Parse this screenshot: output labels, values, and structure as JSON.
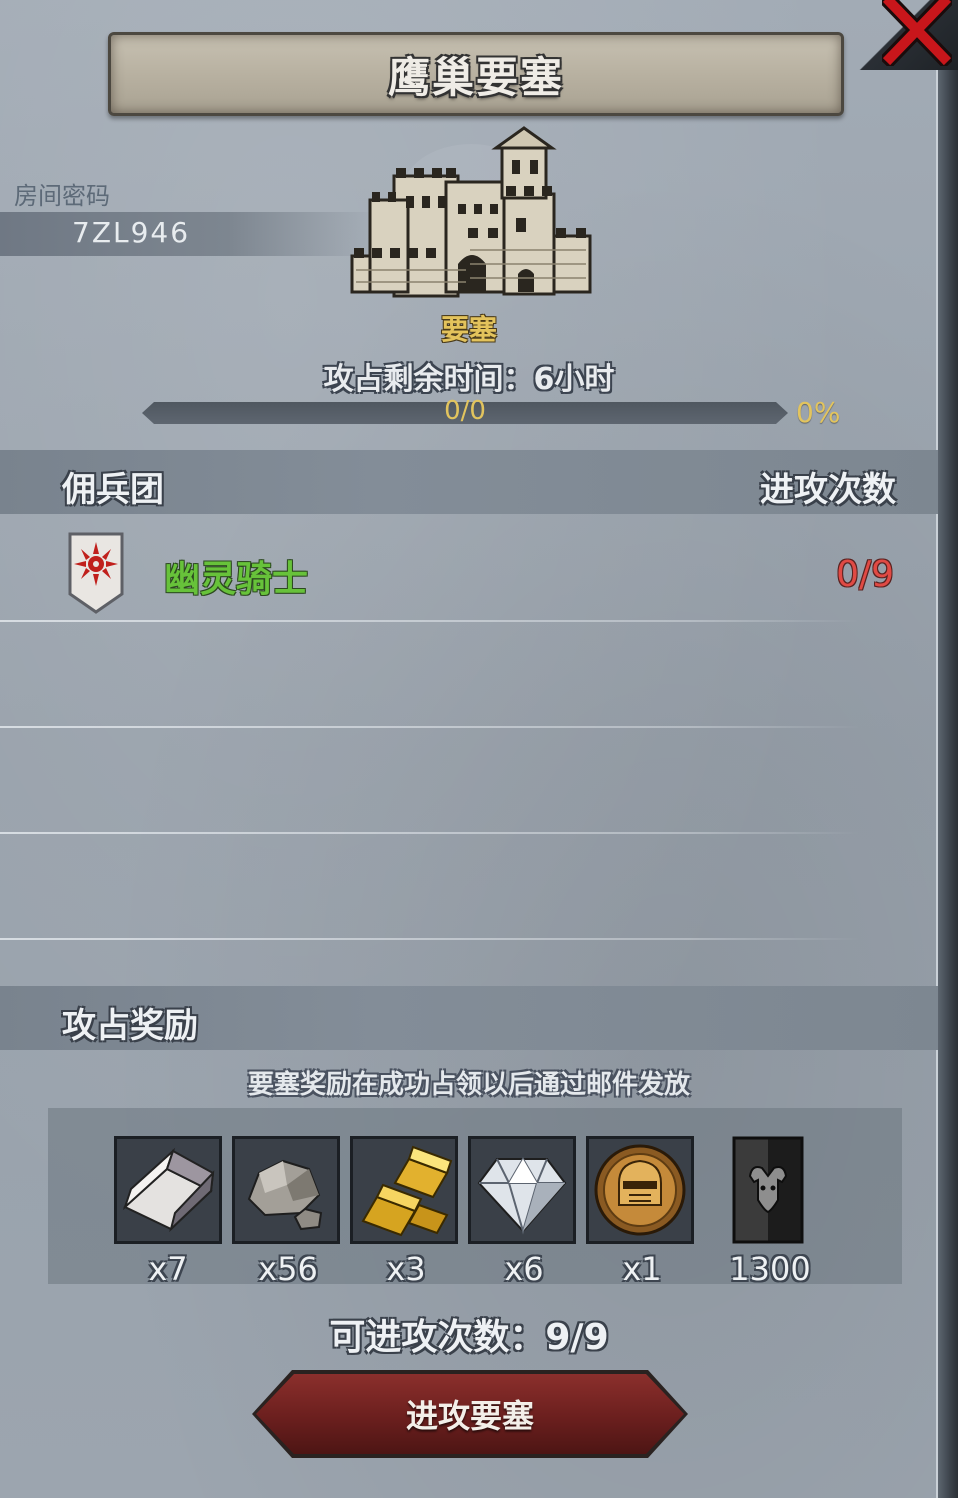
{
  "title": "鹰巢要塞",
  "room": {
    "label": "房间密码",
    "code": "7ZL946"
  },
  "fortress": {
    "type_label": "要塞",
    "time_label": "攻占剩余时间：6小时",
    "progress_text": "0/0",
    "progress_percent": "0%",
    "progress_fraction": 0
  },
  "mercenaries": {
    "header_left": "佣兵团",
    "header_right": "进攻次数",
    "items": [
      {
        "name": "幽灵骑士",
        "attacks": "0/9",
        "emblem_icon": "red-sun-shield-icon"
      }
    ]
  },
  "rewards": {
    "header": "攻占奖励",
    "note": "要塞奖励在成功占领以后通过邮件发放",
    "items": [
      {
        "icon": "silver-ingot-icon",
        "qty": "x7"
      },
      {
        "icon": "stone-ore-icon",
        "qty": "x56"
      },
      {
        "icon": "gold-bars-icon",
        "qty": "x3"
      },
      {
        "icon": "diamond-icon",
        "qty": "x6"
      },
      {
        "icon": "knight-helmet-medal-icon",
        "qty": "x1"
      },
      {
        "icon": "bull-banner-icon",
        "qty": "1300"
      }
    ]
  },
  "attacks_available": "可进攻次数：9/9",
  "attack_button_label": "进攻要塞",
  "colors": {
    "merc_name": "#67c23a",
    "merc_count": "#e04a44",
    "fortress_label": "#e3c35c",
    "button": "#6b1f1e",
    "close": "#c8161b"
  }
}
